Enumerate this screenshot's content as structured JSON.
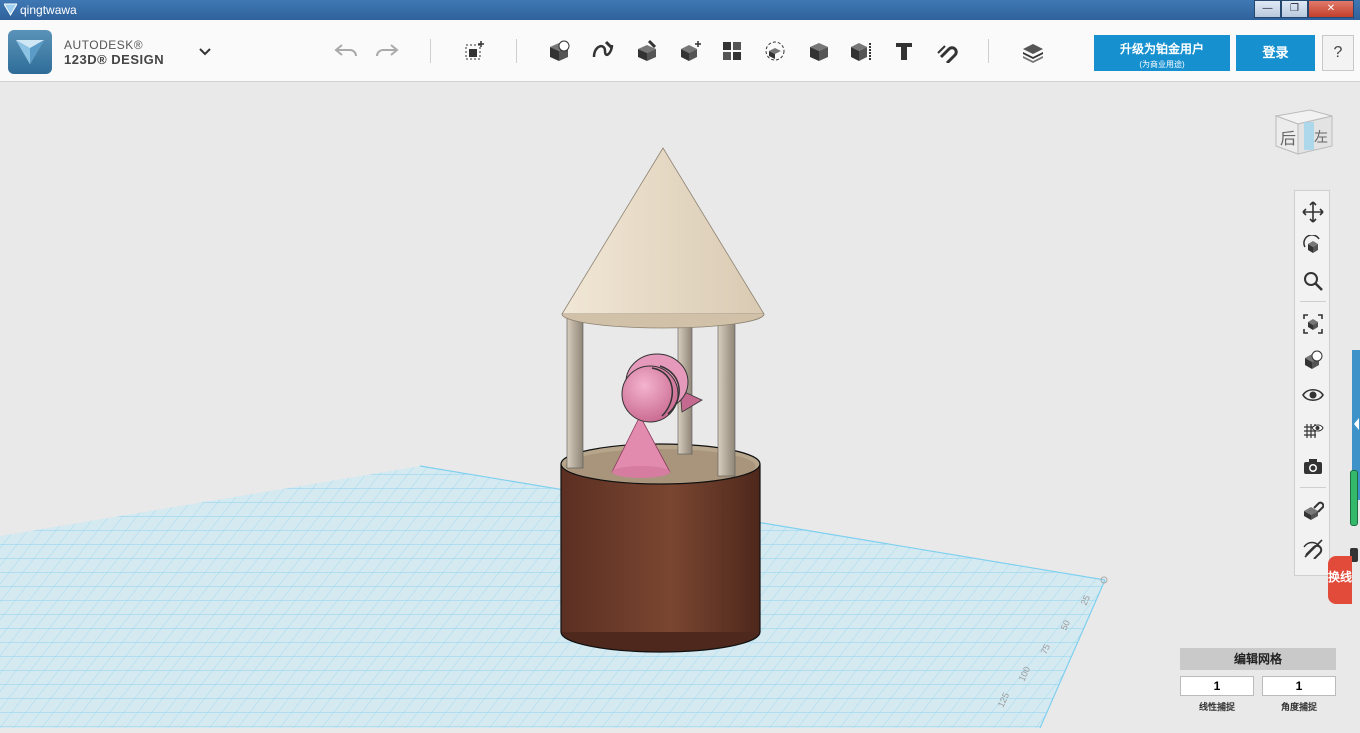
{
  "window": {
    "title": "qingtwawa"
  },
  "brand": {
    "line1": "AUTODESK®",
    "line2": "123D® DESIGN"
  },
  "toolbar": {
    "tools": [
      "undo-icon",
      "redo-icon",
      "primitives-icon",
      "sketch-icon",
      "construct-icon",
      "modify-icon",
      "pattern-icon",
      "grouping-icon",
      "combine-icon",
      "measure-icon",
      "text-icon",
      "snap-icon",
      "material-icon"
    ]
  },
  "account": {
    "upgrade_label": "升级为铂金用户",
    "upgrade_sub": "(为商业用途)",
    "login_label": "登录",
    "help_label": "?"
  },
  "viewcube": {
    "face_front": "后",
    "face_side": "左"
  },
  "grid": {
    "title": "编辑网格",
    "linear_snap_value": "1",
    "angle_snap_value": "1",
    "linear_snap_label": "线性捕捉",
    "angle_snap_label": "角度捕捉",
    "ruler_ticks": [
      "25",
      "50",
      "75",
      "100",
      "125"
    ]
  },
  "side_badge": {
    "text": "换线"
  },
  "colors": {
    "accent": "#1790d0",
    "grid_line": "#5fc3e6",
    "roof": "#e9ddc9",
    "base": "#6b3a2a",
    "figure": "#e68db1"
  }
}
